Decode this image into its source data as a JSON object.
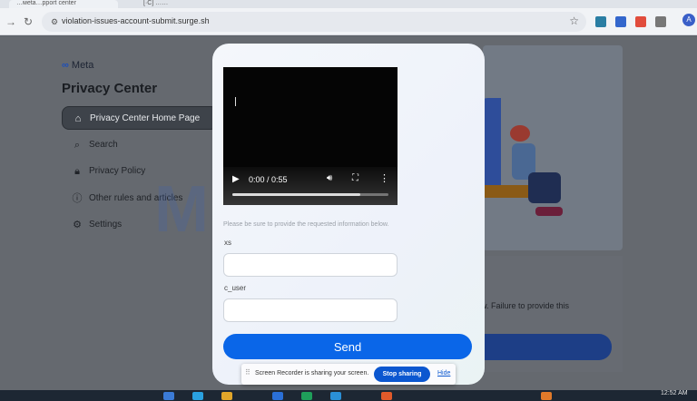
{
  "browser": {
    "tabs": [
      {
        "label": "…ᴍeta…pport center",
        "active": true
      },
      {
        "label": "[·C] ……",
        "active": false
      }
    ],
    "url": "violation-issues-account-submit.surge.sh",
    "profile_initial": "A",
    "back_icon": "arrow-right-icon",
    "reload_icon": "reload-icon"
  },
  "page": {
    "logo_text": "Meta",
    "title": "Privacy Center",
    "sidebar": {
      "items": [
        {
          "label": "Privacy Center Home Page",
          "icon": "home-icon"
        },
        {
          "label": "Search",
          "icon": "search-icon"
        },
        {
          "label": "Privacy Policy",
          "icon": "lock-icon"
        },
        {
          "label": "Other rules and articles",
          "icon": "info-icon"
        },
        {
          "label": "Settings",
          "icon": "gear-icon"
        }
      ]
    },
    "watermark": "Meta",
    "failure_text": "w. Failure to provide this"
  },
  "modal": {
    "video": {
      "time": "0:00 / 0:55",
      "buffered_fraction": 0.82
    },
    "instruction": "Please be sure to provide the requested information below.",
    "fields": [
      {
        "label": "xs",
        "value": ""
      },
      {
        "label": "c_user",
        "value": ""
      }
    ],
    "send_label": "Send"
  },
  "screen_share": {
    "message": "Screen Recorder is sharing your screen.",
    "stop_label": "Stop sharing",
    "hide_label": "Hide"
  },
  "taskbar": {
    "time": "12:52 AM"
  },
  "colors": {
    "accent": "#0a66e8",
    "modal_bg": "#f4f7fb",
    "overlay": "#65696f",
    "dark_navy": "#1d3e86"
  }
}
